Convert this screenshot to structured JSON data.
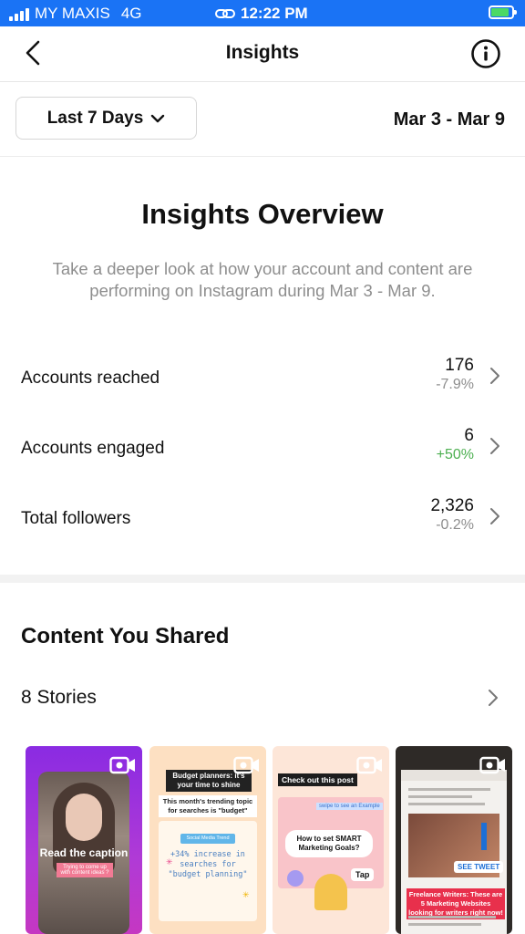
{
  "status_bar": {
    "carrier": "MY MAXIS",
    "network": "4G",
    "time": "12:22 PM",
    "battery_level": 0.85,
    "battery_color": "#4cd964",
    "bar_color": "#1a73f5"
  },
  "header": {
    "title": "Insights",
    "back_icon": "chevron-left-icon",
    "info_icon": "info-circle-icon"
  },
  "filter": {
    "range_label": "Last 7 Days",
    "date_range": "Mar 3 - Mar 9"
  },
  "overview": {
    "title": "Insights Overview",
    "description": "Take a deeper look at how your account and content are performing on Instagram during Mar 3 - Mar 9."
  },
  "metrics": [
    {
      "label": "Accounts reached",
      "value": "176",
      "change": "-7.9%",
      "trend": "negative"
    },
    {
      "label": "Accounts engaged",
      "value": "6",
      "change": "+50%",
      "trend": "positive"
    },
    {
      "label": "Total followers",
      "value": "2,326",
      "change": "-0.2%",
      "trend": "negative"
    }
  ],
  "content": {
    "title": "Content You Shared",
    "stories_label": "8 Stories"
  },
  "thumbnails": [
    {
      "caption": "Read the caption",
      "subcaption": "Trying to come up with content ideas ?"
    },
    {
      "line1": "Budget planners: it's your time to shine",
      "line2": "This month's trending topic for searches is \"budget\"",
      "pill": "Social Media Trend",
      "stat": "+34% increase in searches for \"budget planning\""
    },
    {
      "header": "Check out this post",
      "swipe": "swipe to see an Example",
      "question": "How to set SMART Marketing Goals?",
      "tap": "Tap"
    },
    {
      "tweet": "SEE TWEET",
      "banner": "Freelance Writers: These are 5 Marketing Websites looking for writers right now!"
    }
  ],
  "colors": {
    "positive": "#4caf50",
    "muted": "#8e8e8e"
  }
}
